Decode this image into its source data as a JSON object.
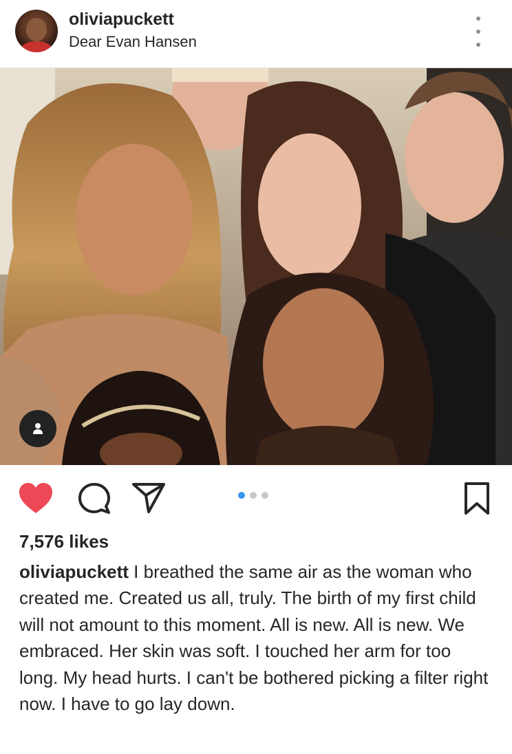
{
  "post": {
    "username": "oliviapuckett",
    "location": "Dear Evan Hansen",
    "likes": "7,576 likes",
    "caption_user": "oliviapuckett",
    "caption_text": " I breathed the same air as the woman who created me. Created us all, truly. The birth of my first child will not amount to this moment. All is new. All is new. We embraced. Her skin was soft. I touched her arm for too long. My head hurts. I can't be bothered picking a filter right now. I have to go lay down."
  },
  "icons": {
    "more": "more-options-icon",
    "like": "heart-icon",
    "comment": "comment-icon",
    "share": "share-icon",
    "save": "bookmark-icon",
    "tag": "user-tag-icon"
  },
  "carousel": {
    "count": 3,
    "active_index": 0
  },
  "colors": {
    "like_red": "#ed4956",
    "carousel_active": "#3897f0",
    "carousel_inactive": "#c8c8c8",
    "text": "#262626"
  }
}
